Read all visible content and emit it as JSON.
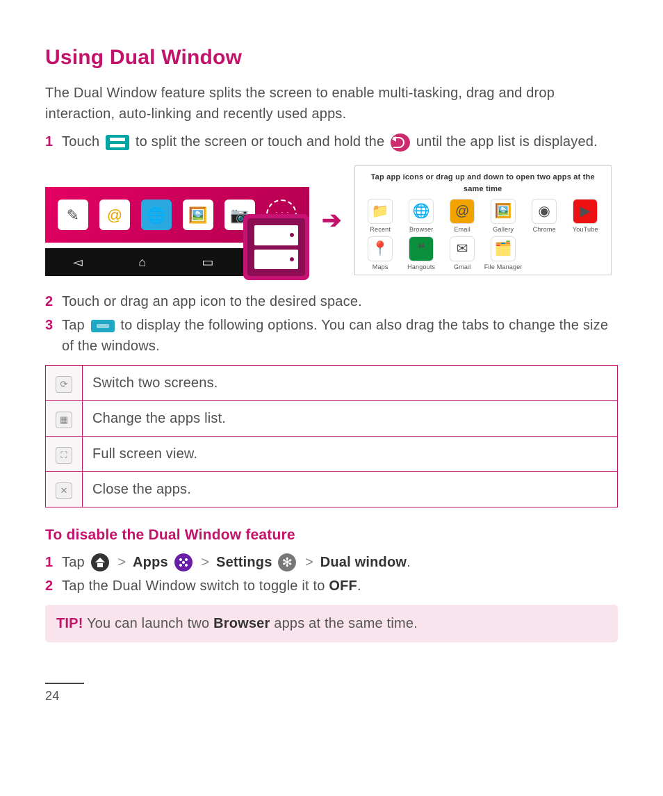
{
  "page": {
    "title": "Using Dual Window",
    "intro": "The Dual Window feature splits the screen to enable multi-tasking, drag and drop interaction, auto-linking and recently used apps.",
    "number": "24"
  },
  "steps": {
    "s1": {
      "num": "1",
      "pre": "Touch ",
      "mid": " to split the screen or touch and hold the ",
      "post": " until the app list is displayed."
    },
    "s2": {
      "num": "2",
      "text": "Touch or drag an app icon to the desired space."
    },
    "s3": {
      "num": "3",
      "pre": "Tap ",
      "post": " to display the following options. You can also drag the tabs to change the size of the windows."
    }
  },
  "app_picker": {
    "title": "Tap app icons or drag up and down to open two apps at the same time",
    "apps": [
      {
        "label": "Recent",
        "glyph": "📁",
        "bg": "#ffffff"
      },
      {
        "label": "Browser",
        "glyph": "🌐",
        "bg": "#ffffff"
      },
      {
        "label": "Email",
        "glyph": "@",
        "bg": "#f3a300"
      },
      {
        "label": "Gallery",
        "glyph": "🖼️",
        "bg": "#ffffff"
      },
      {
        "label": "Chrome",
        "glyph": "◉",
        "bg": "#ffffff"
      },
      {
        "label": "YouTube",
        "glyph": "▶",
        "bg": "#e11"
      },
      {
        "label": "Maps",
        "glyph": "📍",
        "bg": "#ffffff"
      },
      {
        "label": "Hangouts",
        "glyph": "❝",
        "bg": "#0a8f3d"
      },
      {
        "label": "Gmail",
        "glyph": "✉",
        "bg": "#ffffff"
      },
      {
        "label": "File Manager",
        "glyph": "🗂️",
        "bg": "#ffffff"
      }
    ]
  },
  "options": [
    {
      "icon": "⟳",
      "desc": "Switch two screens."
    },
    {
      "icon": "▦",
      "desc": "Change the apps list."
    },
    {
      "icon": "⛶",
      "desc": "Full screen view."
    },
    {
      "icon": "✕",
      "desc": "Close the apps."
    }
  ],
  "disable": {
    "heading": "To disable the Dual Window feature",
    "d1": {
      "num": "1",
      "tap": "Tap ",
      "apps": "Apps",
      "settings": "Settings",
      "dual": "Dual window",
      "sep": ">",
      "period": "."
    },
    "d2": {
      "num": "2",
      "pre": "Tap the Dual Window switch to toggle it to ",
      "off": "OFF",
      "period": "."
    }
  },
  "tip": {
    "label": "TIP!",
    "pre": " You can launch two ",
    "bold": "Browser",
    "post": " apps at the same time."
  }
}
